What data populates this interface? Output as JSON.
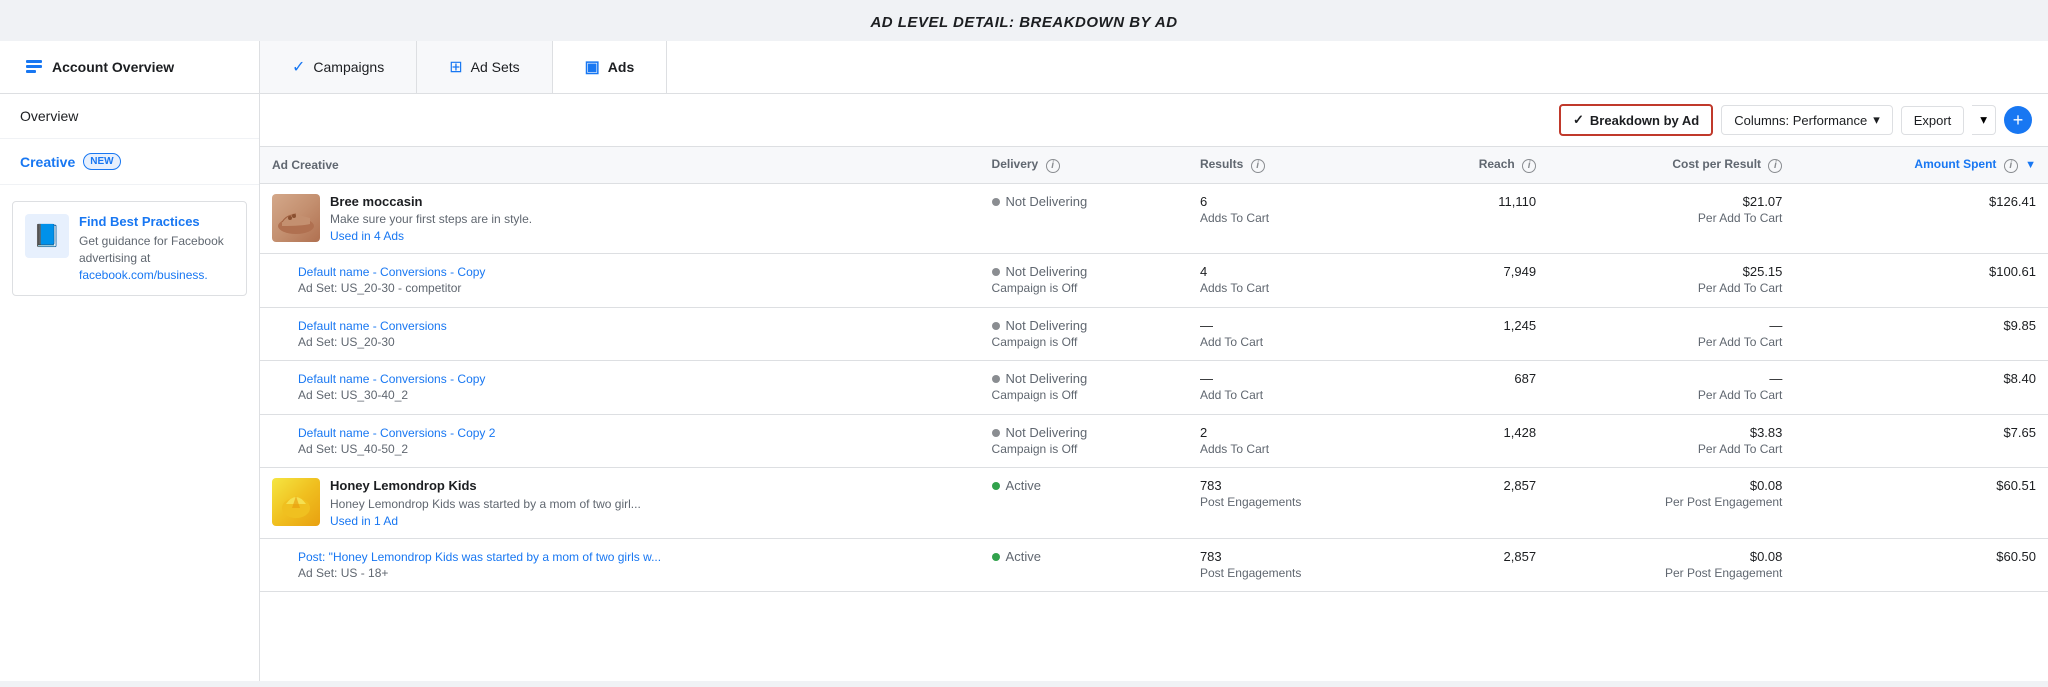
{
  "page": {
    "title": "AD LEVEL DETAIL: BREAKDOWN BY AD"
  },
  "nav": {
    "account_label": "Account Overview",
    "tabs": [
      {
        "id": "campaigns",
        "label": "Campaigns",
        "icon": "✓",
        "active": false
      },
      {
        "id": "ad-sets",
        "label": "Ad Sets",
        "icon": "⊞",
        "active": false
      },
      {
        "id": "ads",
        "label": "Ads",
        "icon": "▣",
        "active": true
      }
    ]
  },
  "sidebar": {
    "overview_label": "Overview",
    "creative_label": "Creative",
    "creative_badge": "NEW",
    "promo": {
      "title": "Find Best Practices",
      "desc": "Get guidance for Facebook advertising at facebook.com/business.",
      "link_text": "facebook.com/business."
    }
  },
  "toolbar": {
    "breakdown_label": "Breakdown by Ad",
    "columns_label": "Columns: Performance",
    "export_label": "Export"
  },
  "table": {
    "columns": [
      {
        "id": "ad-creative",
        "label": "Ad Creative",
        "numeric": false
      },
      {
        "id": "delivery",
        "label": "Delivery",
        "numeric": false,
        "info": true
      },
      {
        "id": "results",
        "label": "Results",
        "numeric": false,
        "info": true
      },
      {
        "id": "reach",
        "label": "Reach",
        "numeric": true,
        "info": true
      },
      {
        "id": "cost-per-result",
        "label": "Cost per Result",
        "numeric": true,
        "info": true
      },
      {
        "id": "amount-spent",
        "label": "Amount Spent",
        "numeric": true,
        "info": true,
        "highlight": true
      }
    ],
    "rows": [
      {
        "type": "parent",
        "has_thumb": true,
        "thumb_type": "shoe",
        "ad_name": "Bree moccasin",
        "ad_desc": "Make sure your first steps are in style.",
        "ad_link": "Used in 4 Ads",
        "delivery_status": "Not Delivering",
        "delivery_sub": "",
        "dot_color": "gray",
        "results_count": "6",
        "results_type": "Adds To Cart",
        "reach": "11,110",
        "cost_main": "$21.07",
        "cost_sub": "Per Add To Cart",
        "amount": "$126.41"
      },
      {
        "type": "sub",
        "has_thumb": false,
        "ad_name": "Default name - Conversions - Copy",
        "ad_set": "Ad Set: US_20-30 - competitor",
        "delivery_status": "Not Delivering",
        "delivery_sub": "Campaign is Off",
        "dot_color": "gray",
        "results_count": "4",
        "results_type": "Adds To Cart",
        "reach": "7,949",
        "cost_main": "$25.15",
        "cost_sub": "Per Add To Cart",
        "amount": "$100.61"
      },
      {
        "type": "sub",
        "has_thumb": false,
        "ad_name": "Default name - Conversions",
        "ad_set": "Ad Set: US_20-30",
        "delivery_status": "Not Delivering",
        "delivery_sub": "Campaign is Off",
        "dot_color": "gray",
        "results_count": "—",
        "results_type": "Add To Cart",
        "reach": "1,245",
        "cost_main": "—",
        "cost_sub": "Per Add To Cart",
        "amount": "$9.85"
      },
      {
        "type": "sub",
        "has_thumb": false,
        "ad_name": "Default name - Conversions - Copy",
        "ad_set": "Ad Set: US_30-40_2",
        "delivery_status": "Not Delivering",
        "delivery_sub": "Campaign is Off",
        "dot_color": "gray",
        "results_count": "—",
        "results_type": "Add To Cart",
        "reach": "687",
        "cost_main": "—",
        "cost_sub": "Per Add To Cart",
        "amount": "$8.40"
      },
      {
        "type": "sub",
        "has_thumb": false,
        "ad_name": "Default name - Conversions - Copy 2",
        "ad_set": "Ad Set: US_40-50_2",
        "delivery_status": "Not Delivering",
        "delivery_sub": "Campaign is Off",
        "dot_color": "gray",
        "results_count": "2",
        "results_type": "Adds To Cart",
        "reach": "1,428",
        "cost_main": "$3.83",
        "cost_sub": "Per Add To Cart",
        "amount": "$7.65"
      },
      {
        "type": "parent",
        "has_thumb": true,
        "thumb_type": "honey",
        "ad_name": "Honey Lemondrop Kids",
        "ad_desc": "Honey Lemondrop Kids was started by a mom of two girl...",
        "ad_link": "Used in 1 Ad",
        "delivery_status": "Active",
        "delivery_sub": "",
        "dot_color": "green",
        "results_count": "783",
        "results_type": "Post Engagements",
        "reach": "2,857",
        "cost_main": "$0.08",
        "cost_sub": "Per Post Engagement",
        "amount": "$60.51"
      },
      {
        "type": "sub",
        "has_thumb": false,
        "ad_name": "Post: \"Honey Lemondrop Kids was started by a mom of two girls w...",
        "ad_set": "Ad Set: US - 18+",
        "delivery_status": "Active",
        "delivery_sub": "",
        "dot_color": "green",
        "results_count": "783",
        "results_type": "Post Engagements",
        "reach": "2,857",
        "cost_main": "$0.08",
        "cost_sub": "Per Post Engagement",
        "amount": "$60.50"
      }
    ]
  }
}
